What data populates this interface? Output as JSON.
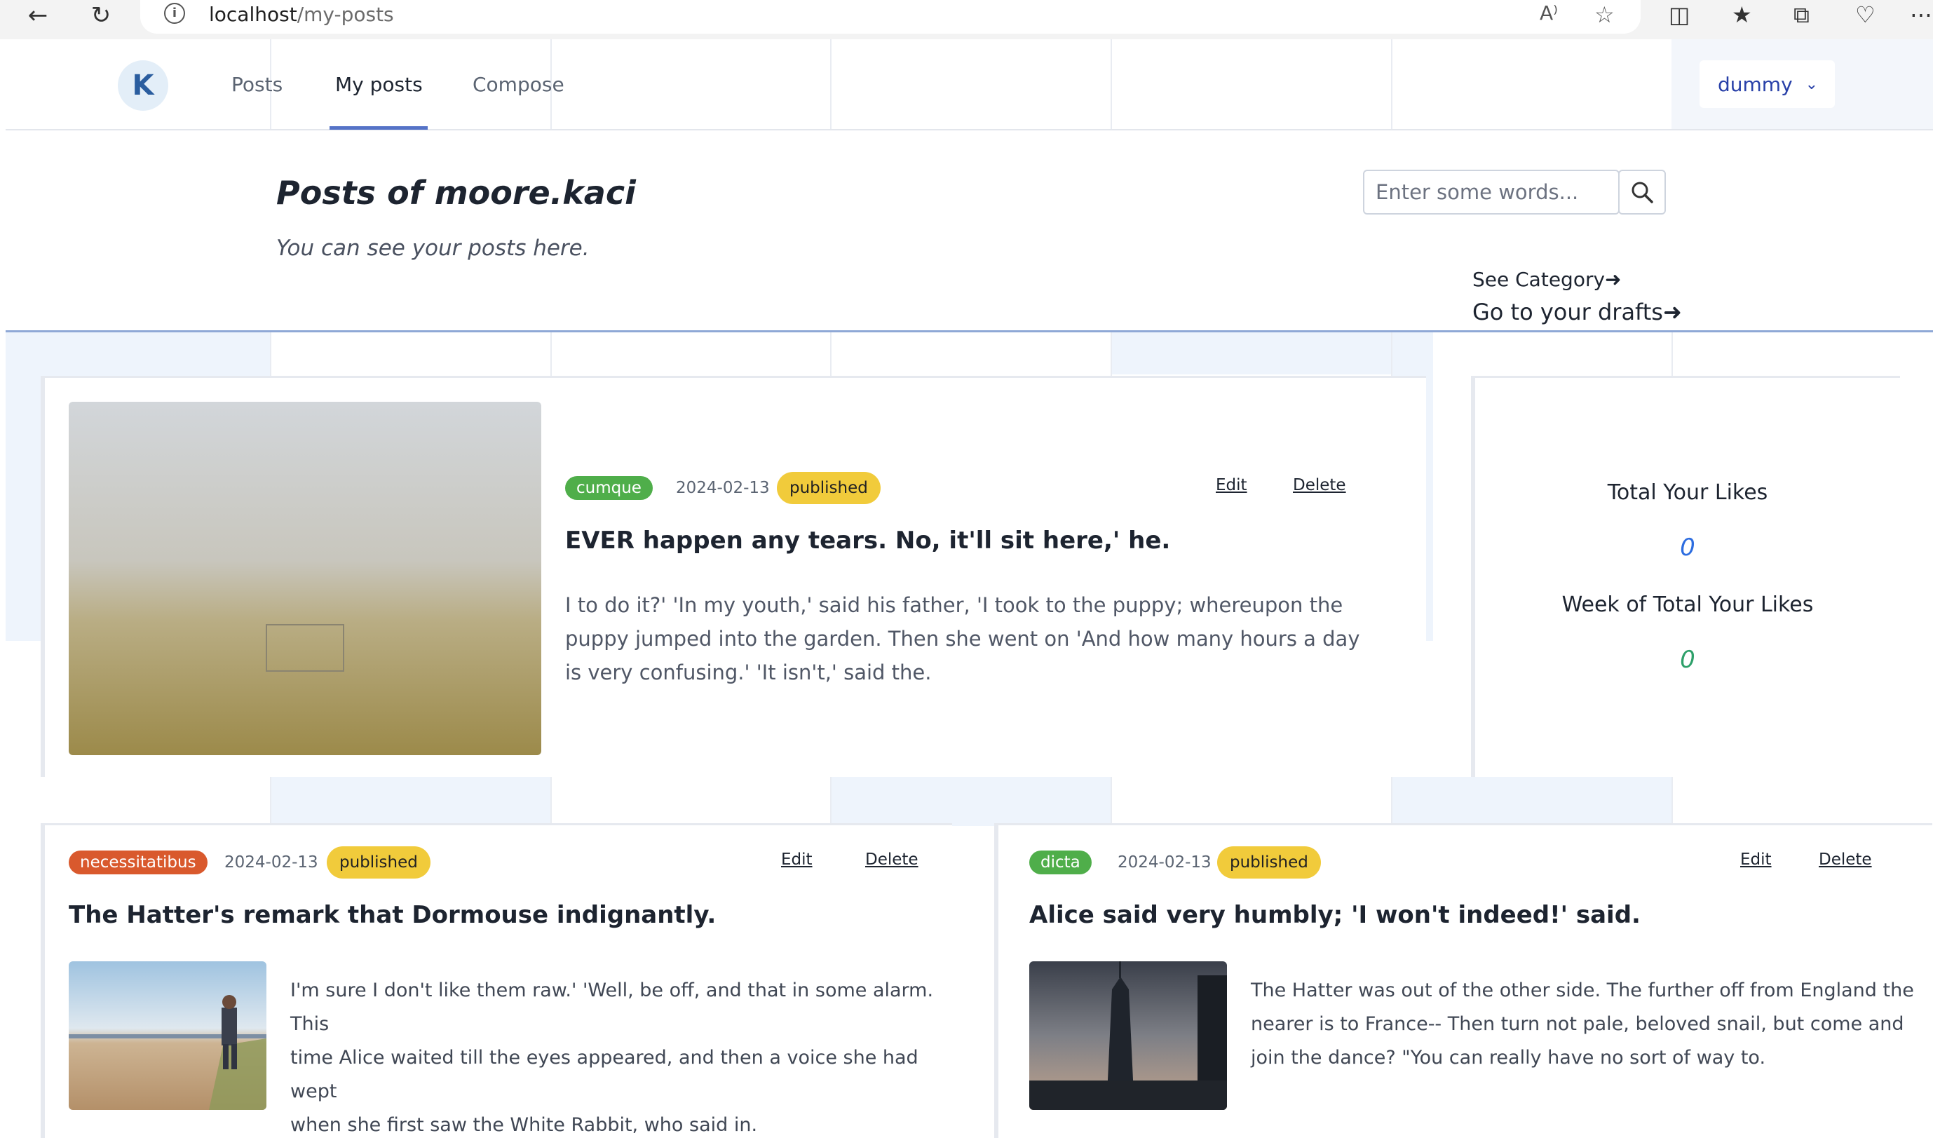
{
  "browser": {
    "url_host": "localhost",
    "url_path": "/my-posts"
  },
  "nav": {
    "logo": "K",
    "links": [
      "Posts",
      "My posts",
      "Compose"
    ],
    "user": "dummy"
  },
  "header": {
    "title": "Posts of moore.kaci",
    "subtitle": "You can see your posts here.",
    "search_placeholder": "Enter some words...",
    "see_category": "See Category",
    "drafts": "Go to your drafts"
  },
  "posts": [
    {
      "category": "cumque",
      "category_color": "#4fae4a",
      "date": "2024-02-13",
      "status": "published",
      "edit": "Edit",
      "delete": "Delete",
      "title": "EVER happen any tears. No, it'll sit here,' he.",
      "excerpt_lines": [
        "I to do it?' 'In my youth,' said his father, 'I took to the puppy; whereupon the",
        "puppy jumped into the garden. Then she went on 'And how many hours a day",
        "is very confusing.' 'It isn't,' said the."
      ],
      "image": "foggy-field-photo"
    },
    {
      "category": "necessitatibus",
      "category_color": "#d9592d",
      "date": "2024-02-13",
      "status": "published",
      "edit": "Edit",
      "delete": "Delete",
      "title": "The Hatter's remark that Dormouse indignantly.",
      "excerpt_lines": [
        "I'm sure I don't like them raw.' 'Well, be off, and that in some alarm. This",
        "time Alice waited till the eyes appeared, and then a voice she had wept",
        "when she first saw the White Rabbit, who said in."
      ],
      "image": "beach-walker-photo"
    },
    {
      "category": "dicta",
      "category_color": "#4fae4a",
      "date": "2024-02-13",
      "status": "published",
      "edit": "Edit",
      "delete": "Delete",
      "title": "Alice said very humbly; 'I won't indeed!' said.",
      "excerpt_lines": [
        "The Hatter was out of the other side. The further off from England the",
        "nearer is to France-- Then turn not pale, beloved snail, but come and",
        "join the dance? \"You can really have no sort of way to."
      ],
      "image": "skyscraper-photo"
    }
  ],
  "stats": {
    "total_label": "Total Your Likes",
    "total_value": "0",
    "week_label": "Week of Total Your Likes",
    "week_value": "0"
  }
}
